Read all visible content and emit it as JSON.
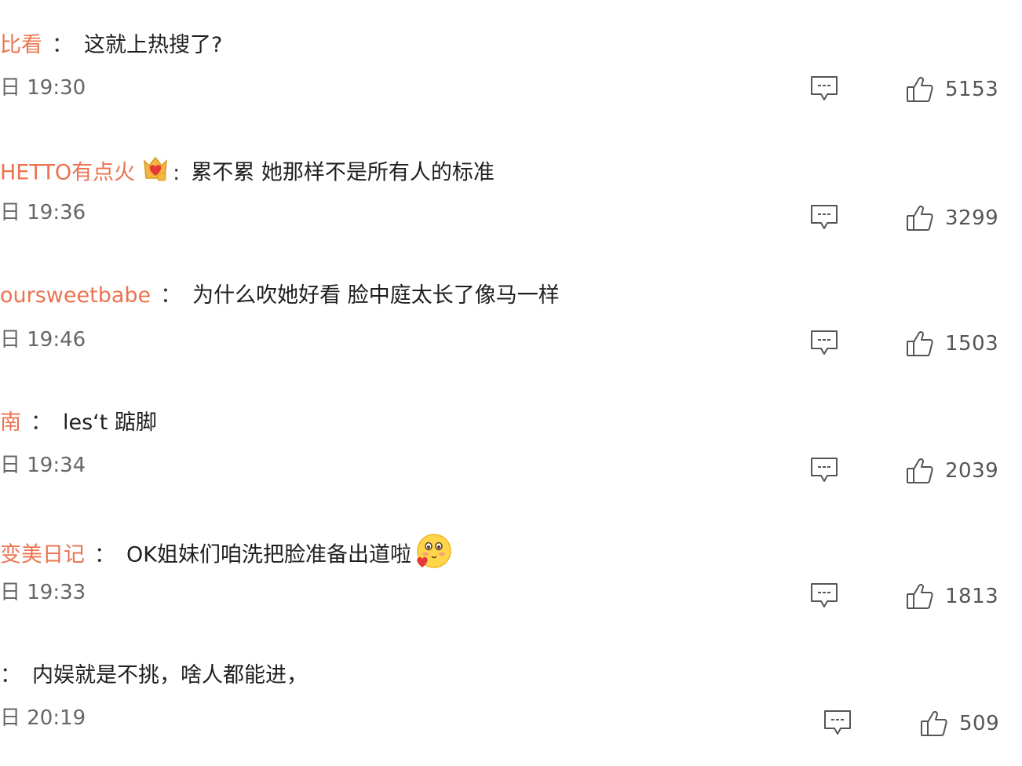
{
  "comments": [
    {
      "user": "比看",
      "separator": "：",
      "text": "这就上热搜了?",
      "date": "日 19:30",
      "likes": "5153"
    },
    {
      "user": "HETTO有点火",
      "separator": ":",
      "text": "累不累 她那样不是所有人的标准",
      "date": "日 19:36",
      "likes": "3299",
      "badge": "crown-heart-badge-icon"
    },
    {
      "user": "oursweetbabe",
      "separator": "：",
      "text": "为什么吹她好看 脸中庭太长了像马一样",
      "date": "日 19:46",
      "likes": "1503"
    },
    {
      "user": "南",
      "separator": "：",
      "text": "les‘t 踮脚",
      "date": "日 19:34",
      "likes": "2039"
    },
    {
      "user": "变美日记",
      "separator": "：",
      "text": "OK姐妹们咱洗把脸准备出道啦",
      "date": "日 19:33",
      "likes": "1813",
      "emoji": "blushing-heart-emoji-icon"
    },
    {
      "user": "",
      "separator": "：",
      "text": "内娱就是不挑，啥人都能进，",
      "date": "日 20:19",
      "likes": "509"
    }
  ],
  "colors": {
    "username": "#eb7350",
    "text": "#1f1f1f",
    "meta": "#666666",
    "icon": "#555555"
  },
  "icons": {
    "reply": "comment-bubble-icon",
    "like": "thumbs-up-icon"
  }
}
